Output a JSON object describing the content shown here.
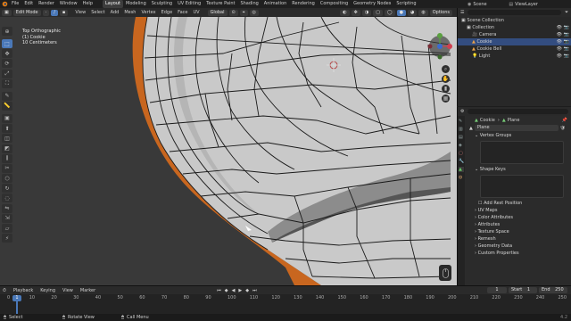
{
  "topbar": {
    "menus": [
      "File",
      "Edit",
      "Render",
      "Window",
      "Help"
    ],
    "workspaces": [
      "Layout",
      "Modeling",
      "Sculpting",
      "UV Editing",
      "Texture Paint",
      "Shading",
      "Animation",
      "Rendering",
      "Compositing",
      "Geometry Nodes",
      "Scripting"
    ],
    "active_workspace": "Layout",
    "scene_label": "Scene",
    "viewlayer_label": "ViewLayer"
  },
  "viewport_header": {
    "mode": "Edit Mode",
    "menus": [
      "View",
      "Select",
      "Add",
      "Mesh",
      "Vertex",
      "Edge",
      "Face",
      "UV"
    ],
    "orientation": "Global",
    "options_label": "Options"
  },
  "viewport_info": {
    "view_name": "Top Orthographic",
    "object_line": "(1) Cookie",
    "scale_line": "10 Centimeters"
  },
  "toolbar": {
    "tools": [
      "cursor-tool",
      "select-box-tool",
      "move-tool",
      "rotate-tool",
      "scale-tool",
      "transform-tool",
      "annotate-tool",
      "measure-tool",
      "add-cube-tool",
      "extrude-tool",
      "inset-tool",
      "bevel-tool",
      "loop-cut-tool",
      "knife-tool",
      "poly-build-tool",
      "spin-tool",
      "smooth-tool",
      "edge-slide-tool",
      "shrink-tool",
      "shear-tool",
      "rip-tool"
    ]
  },
  "outliner": {
    "root": "Scene Collection",
    "items": [
      {
        "label": "Collection",
        "indent": 1,
        "selected": false
      },
      {
        "label": "Camera",
        "indent": 2,
        "selected": false
      },
      {
        "label": "Cookie",
        "indent": 2,
        "selected": true
      },
      {
        "label": "Cookie Bell",
        "indent": 2,
        "selected": false
      },
      {
        "label": "Light",
        "indent": 2,
        "selected": false
      }
    ]
  },
  "properties": {
    "breadcrumb_object": "Cookie",
    "breadcrumb_data": "Plane",
    "data_name": "Plane",
    "panels": {
      "vertex_groups": "Vertex Groups",
      "shape_keys": "Shape Keys",
      "add_rest_position": "Add Rest Position",
      "uv_maps": "UV Maps",
      "color_attributes": "Color Attributes",
      "attributes": "Attributes",
      "texture_space": "Texture Space",
      "remesh": "Remesh",
      "geometry_data": "Geometry Data",
      "custom_properties": "Custom Properties"
    }
  },
  "timeline": {
    "menus": [
      "Playback",
      "Keying",
      "View",
      "Marker"
    ],
    "current_frame": "1",
    "start_label": "Start",
    "start_value": "1",
    "end_label": "End",
    "end_value": "250",
    "ticks": [
      "0",
      "10",
      "20",
      "30",
      "40",
      "50",
      "60",
      "70",
      "80",
      "90",
      "100",
      "110",
      "120",
      "130",
      "140",
      "150",
      "160",
      "170",
      "180",
      "190",
      "200",
      "210",
      "220",
      "230",
      "240",
      "250"
    ]
  },
  "statusbar": {
    "select": "Select",
    "rotate": "Rotate View",
    "call_menu": "Call Menu",
    "version": "4.2"
  },
  "colors": {
    "accent": "#4a78b8",
    "mesh_face": "#c8c8c8",
    "mesh_edge": "#1a1a1a",
    "rim_orange": "#c8661f",
    "viewport_bg": "#393939",
    "selected_row": "#334d80"
  }
}
